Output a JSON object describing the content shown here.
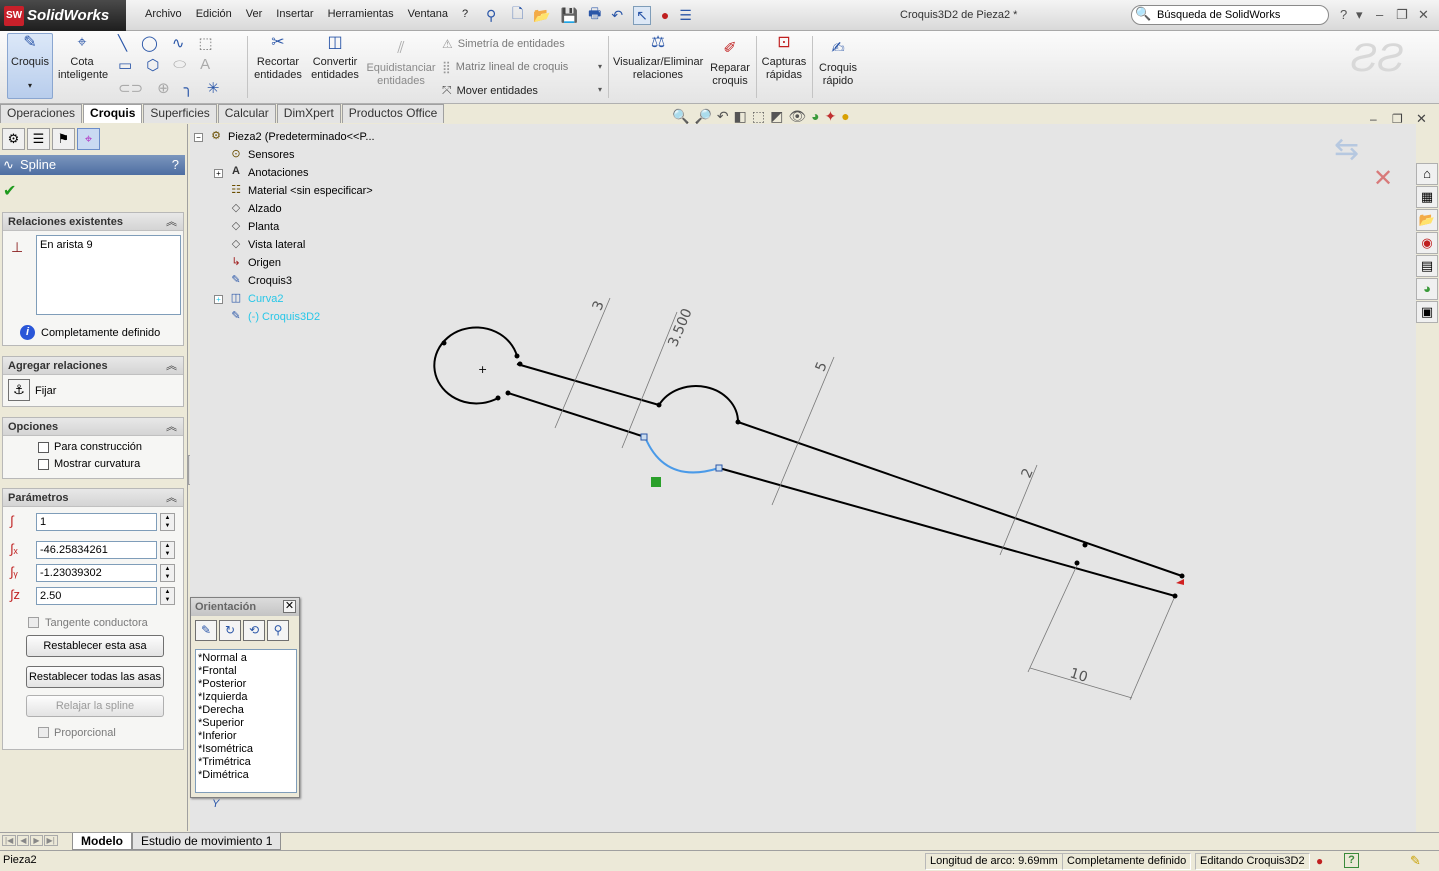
{
  "app": {
    "name": "SolidWorks",
    "doc_title": "Croquis3D2 de Pieza2 *"
  },
  "menu": [
    "Archivo",
    "Edición",
    "Ver",
    "Insertar",
    "Herramientas",
    "Ventana",
    "?"
  ],
  "search": {
    "placeholder": "Búsqueda de SolidWorks"
  },
  "commands": {
    "croquis": "Croquis",
    "cota": "Cota inteligente",
    "recortar": "Recortar entidades",
    "convertir": "Convertir entidades",
    "equidistanciar": "Equidistanciar entidades",
    "simetria": "Simetría de entidades",
    "matriz": "Matriz lineal de croquis",
    "mover": "Mover entidades",
    "visualizar": "Visualizar/Eliminar relaciones",
    "reparar": "Reparar croquis",
    "capturas": "Capturas rápidas",
    "croquis_rapido": "Croquis rápido"
  },
  "tabs": [
    "Operaciones",
    "Croquis",
    "Superficies",
    "Calcular",
    "DimXpert",
    "Productos Office"
  ],
  "active_tab": "Croquis",
  "property_manager": {
    "title": "Spline",
    "help": "?",
    "existing_relations": {
      "header": "Relaciones existentes",
      "items": [
        "En arista 9"
      ],
      "status": "Completamente definido"
    },
    "add_relations": {
      "header": "Agregar relaciones",
      "fix": "Fijar"
    },
    "options": {
      "header": "Opciones",
      "construction": "Para construcción",
      "show_curvature": "Mostrar curvatura"
    },
    "parameters": {
      "header": "Parámetros",
      "point": "1",
      "x": "-46.25834261",
      "y": "-1.23039302",
      "z": "2.50",
      "tangent_driving": "Tangente conductora",
      "reset_handle": "Restablecer esta asa",
      "reset_all": "Restablecer todas las asas",
      "relax": "Relajar la spline",
      "proportional": "Proporcional"
    }
  },
  "tree": {
    "root": "Pieza2  (Predeterminado<<P...",
    "items": [
      "Sensores",
      "Anotaciones",
      "Material <sin especificar>",
      "Alzado",
      "Planta",
      "Vista lateral",
      "Origen",
      "Croquis3",
      "Curva2",
      "(-) Croquis3D2"
    ]
  },
  "dimensions": [
    "3",
    "3.500",
    "5",
    "2",
    "10"
  ],
  "orientation": {
    "title": "Orientación",
    "views": [
      "*Normal a",
      "*Frontal",
      "*Posterior",
      "*Izquierda",
      "*Derecha",
      "*Superior",
      "*Inferior",
      "*Isométrica",
      "*Trimétrica",
      "*Dimétrica"
    ]
  },
  "bottom_tabs": [
    "Modelo",
    "Estudio de movimiento 1"
  ],
  "status": {
    "doc": "Pieza2",
    "arc_length": "Longitud de arco: 9.69mm",
    "definition": "Completamente definido",
    "editing": "Editando Croquis3D2"
  },
  "colors": {
    "accent": "#2a56a8",
    "selected_curve": "#4a9ae8",
    "tree_highlight": "#28c7e8",
    "title_blue": "#4e6ea2"
  }
}
